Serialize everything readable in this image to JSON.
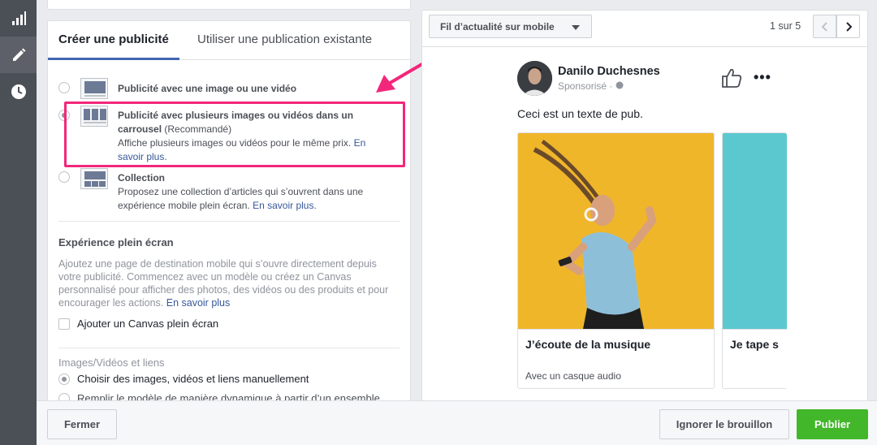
{
  "sidebar": {
    "items": [
      {
        "icon": "bar-chart-icon",
        "active": false
      },
      {
        "icon": "pencil-icon",
        "active": true
      },
      {
        "icon": "clock-icon",
        "active": false
      }
    ]
  },
  "editor": {
    "tabs": [
      {
        "label": "Créer une publicité",
        "active": true
      },
      {
        "label": "Utiliser une publication existante",
        "active": false
      }
    ],
    "formats": [
      {
        "title": "Publicité avec une image ou une vidéo",
        "selected": false
      },
      {
        "title": "Publicité avec plusieurs images ou vidéos dans un carrousel",
        "badge": "(Recommandé)",
        "description": "Affiche plusieurs images ou vidéos pour le même prix.",
        "link": "En savoir plus.",
        "selected": true
      },
      {
        "title": "Collection",
        "description": "Proposez une collection d’articles qui s’ouvrent dans une expérience mobile plein écran.",
        "link": "En savoir plus.",
        "selected": false
      }
    ],
    "fullscreen": {
      "heading": "Expérience plein écran",
      "description": "Ajoutez une page de destination mobile qui s’ouvre directement depuis votre publicité. Commencez avec un modèle ou créez un Canvas personnalisé pour afficher des photos, des vidéos ou des produits et pour encourager les actions.",
      "link": "En savoir plus",
      "checkbox_label": "Ajouter un Canvas plein écran"
    },
    "media": {
      "heading": "Images/Vidéos et liens",
      "options": [
        {
          "label": "Choisir des images, vidéos et liens manuellement",
          "selected": true
        },
        {
          "label": "Remplir le modèle de manière dynamique à partir d’un ensemble",
          "selected": false
        }
      ]
    }
  },
  "preview": {
    "placement": "Fil d’actualité sur mobile",
    "page_count": "1 sur 5",
    "post": {
      "author": "Danilo Duchesnes",
      "sponsored": "Sponsorisé · ",
      "text": "Ceci est un texte de pub.",
      "cards": [
        {
          "title": "J’écoute de la musique",
          "subtitle": "Avec un casque audio"
        },
        {
          "title": "Je tape s"
        }
      ]
    }
  },
  "footer": {
    "close_label": "Fermer",
    "discard_label": "Ignorer le brouillon",
    "publish_label": "Publier"
  },
  "colors": {
    "accent": "#4267b2",
    "highlight": "#f2277c",
    "publish": "#42b72a"
  }
}
